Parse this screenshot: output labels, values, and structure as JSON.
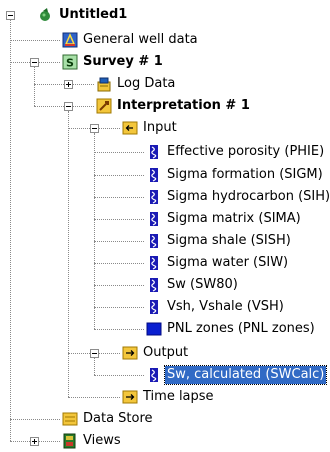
{
  "tree": [
    {
      "label": "Untitled1",
      "icon": "globe-icon",
      "bold": true,
      "expander": "expanded"
    },
    {
      "label": "General well data",
      "icon": "well-data-icon",
      "bold": false,
      "expander": "none"
    },
    {
      "label": "Survey # 1",
      "icon": "survey-icon",
      "bold": true,
      "expander": "expanded"
    },
    {
      "label": "Log Data",
      "icon": "log-data-icon",
      "bold": false,
      "expander": "collapsed"
    },
    {
      "label": "Interpretation # 1",
      "icon": "interpretation-icon",
      "bold": true,
      "expander": "expanded"
    },
    {
      "label": "Input",
      "icon": "input-folder-icon",
      "bold": false,
      "expander": "expanded"
    },
    {
      "label": "Effective porosity (PHIE)",
      "icon": "curve-icon",
      "bold": false,
      "expander": "none"
    },
    {
      "label": "Sigma formation (SIGM)",
      "icon": "curve-icon",
      "bold": false,
      "expander": "none"
    },
    {
      "label": "Sigma hydrocarbon (SIH)",
      "icon": "curve-icon",
      "bold": false,
      "expander": "none"
    },
    {
      "label": "Sigma matrix (SIMA)",
      "icon": "curve-icon",
      "bold": false,
      "expander": "none"
    },
    {
      "label": "Sigma shale (SISH)",
      "icon": "curve-icon",
      "bold": false,
      "expander": "none"
    },
    {
      "label": "Sigma water (SIW)",
      "icon": "curve-icon",
      "bold": false,
      "expander": "none"
    },
    {
      "label": "Sw (SW80)",
      "icon": "curve-icon",
      "bold": false,
      "expander": "none"
    },
    {
      "label": "Vsh, Vshale (VSH)",
      "icon": "curve-icon",
      "bold": false,
      "expander": "none"
    },
    {
      "label": "PNL zones (PNL zones)",
      "icon": "zones-icon",
      "bold": false,
      "expander": "none"
    },
    {
      "label": "Output",
      "icon": "output-folder-icon",
      "bold": false,
      "expander": "expanded"
    },
    {
      "label": "Sw, calculated (SWCalc)",
      "icon": "curve-icon",
      "bold": false,
      "expander": "none",
      "selected": true
    },
    {
      "label": "Time lapse",
      "icon": "time-lapse-icon",
      "bold": false,
      "expander": "none"
    },
    {
      "label": "Data Store",
      "icon": "data-store-icon",
      "bold": false,
      "expander": "none"
    },
    {
      "label": "Views",
      "icon": "views-icon",
      "bold": false,
      "expander": "collapsed"
    }
  ],
  "colors": {
    "selection": "#316ac5",
    "curve_blue": "#1a1ab4",
    "folder_yellow": "#f3c63b"
  }
}
